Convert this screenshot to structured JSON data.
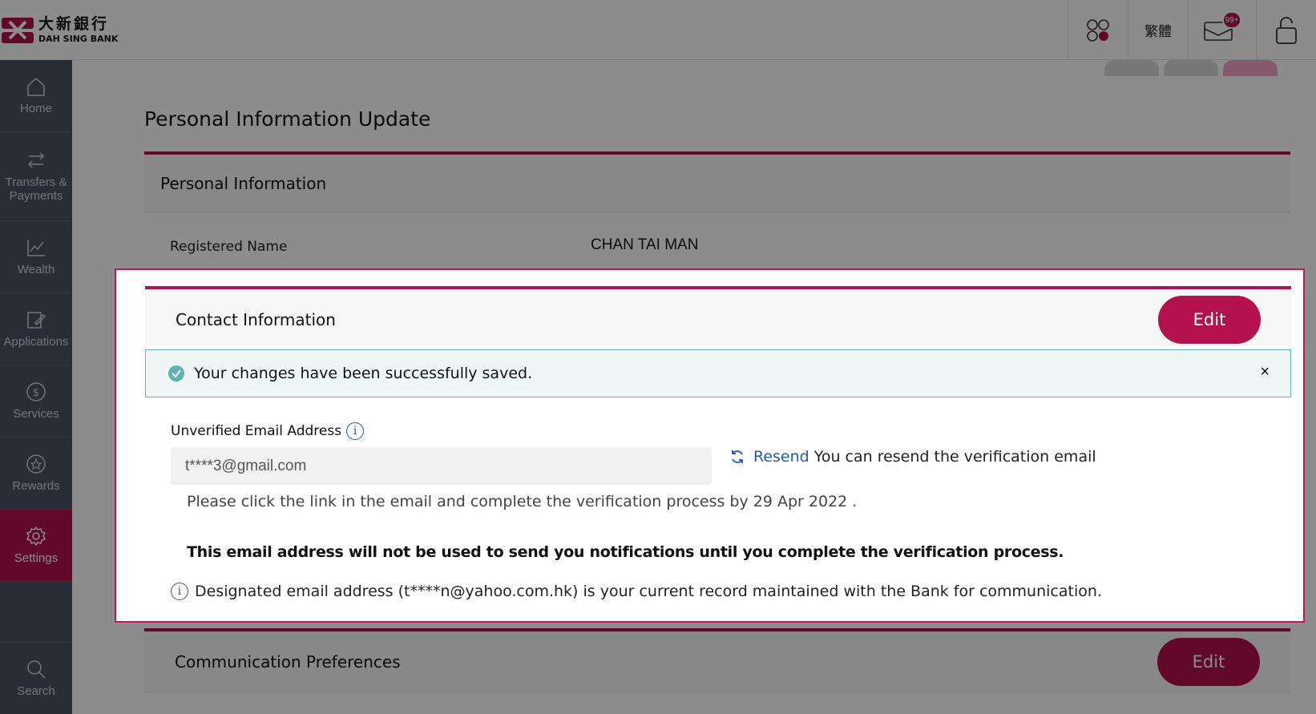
{
  "header": {
    "logo_cn": "大新銀行",
    "logo_en": "DAH SING BANK",
    "lang_label": "繁體",
    "mail_badge": "99+"
  },
  "sidebar": {
    "items": [
      {
        "label": "Home",
        "icon": "home-icon"
      },
      {
        "label": "Transfers & Payments",
        "icon": "transfer-icon"
      },
      {
        "label": "Wealth",
        "icon": "chart-icon"
      },
      {
        "label": "Applications",
        "icon": "edit-doc-icon"
      },
      {
        "label": "Services",
        "icon": "dollar-circle-icon"
      },
      {
        "label": "Rewards",
        "icon": "star-circle-icon"
      },
      {
        "label": "Settings",
        "icon": "gear-icon",
        "active": true
      },
      {
        "label": "Search",
        "icon": "search-icon"
      }
    ]
  },
  "page": {
    "title": "Personal Information Update",
    "personal_section_title": "Personal Information",
    "registered_name_label": "Registered Name",
    "registered_name_value": "CHAN TAI MAN",
    "contact_section_title": "Contact Information",
    "edit_label": "Edit",
    "success_message": "Your changes have been successfully saved.",
    "close_symbol": "×",
    "unverified_email_label": "Unverified Email Address",
    "unverified_email_value": "t****3@gmail.com",
    "resend_link": "Resend",
    "resend_desc": "You can resend the verification email",
    "verify_note": "Please click the link in the email and complete the verification process by 29 Apr 2022 .",
    "warning": "This email address will not be used to send you notifications until you complete the verification process.",
    "designated_note": "Designated email address (t****n@yahoo.com.hk) is your current record maintained with the Bank for communication.",
    "comm_section_title": "Communication Preferences",
    "comm_edit_label": "Edit"
  },
  "colors": {
    "brand": "#b3124e",
    "sidebar_bg": "#4b5563",
    "success": "#5fb4ad",
    "link": "#1e5bb8"
  }
}
